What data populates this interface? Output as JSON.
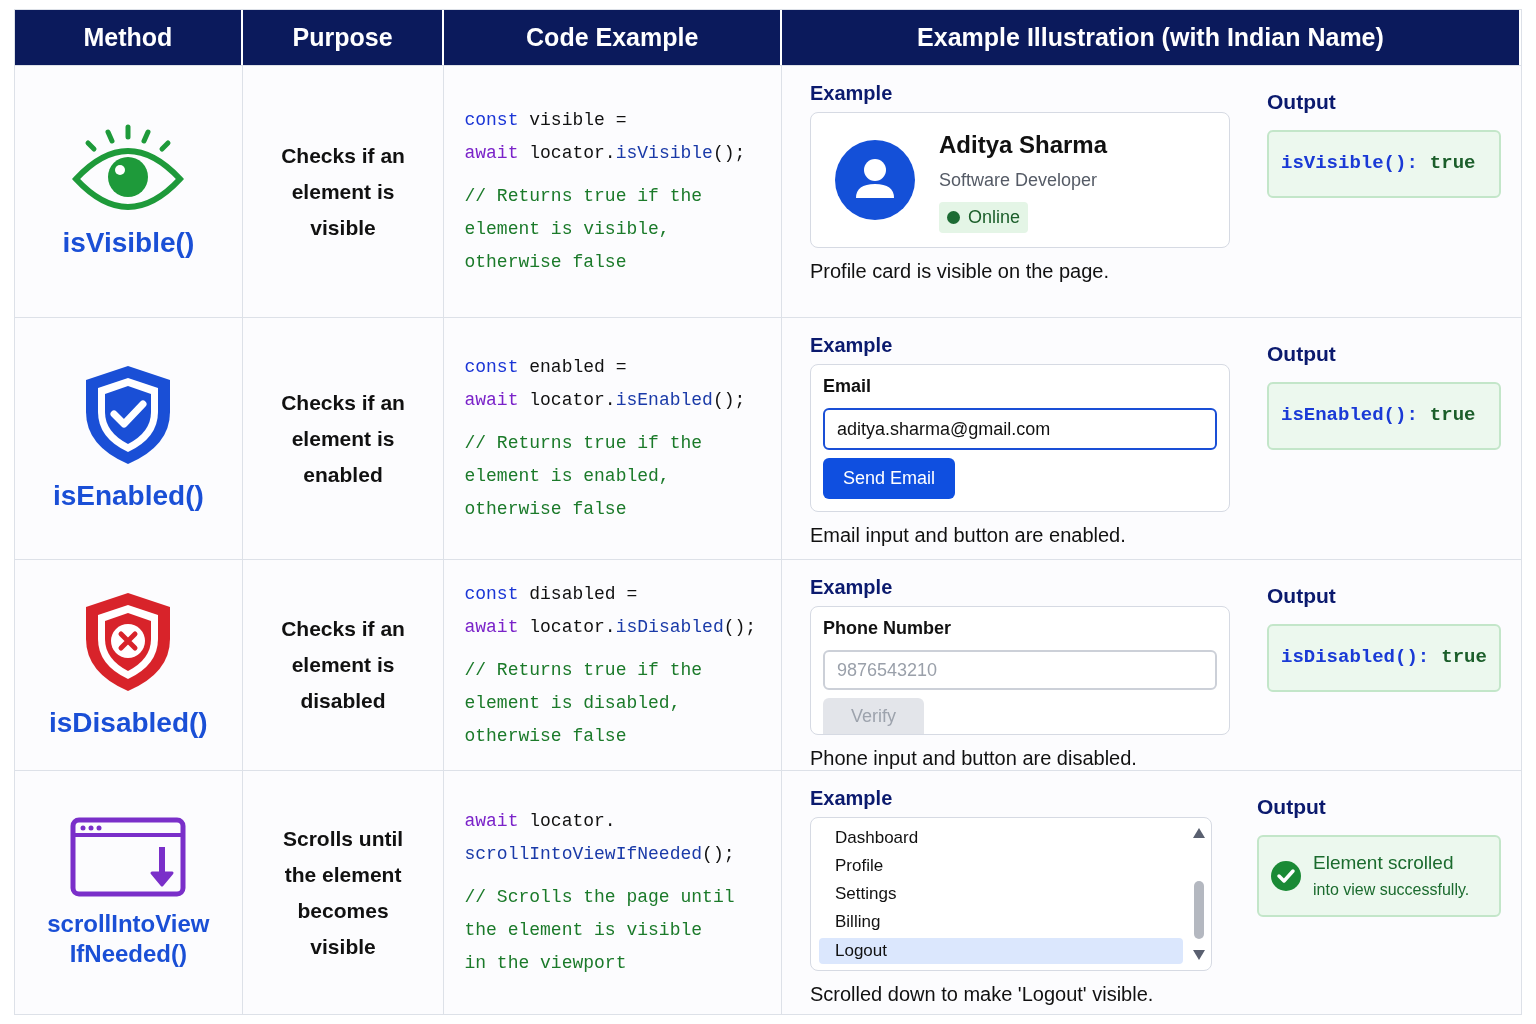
{
  "table": {
    "columns": [
      "Method",
      "Purpose",
      "Code Example",
      "Example Illustration (with Indian Name)"
    ],
    "rows": [
      {
        "kind": "eye",
        "method": [
          "isVisible()"
        ],
        "purpose": "Checks if an element is visible",
        "code": [
          [
            {
              "kind": "keyword",
              "text": "const"
            },
            {
              "kind": "plain",
              "text": " visible ="
            }
          ],
          [
            {
              "kind": "await",
              "text": "await"
            },
            {
              "kind": "plain",
              "text": " locator."
            },
            {
              "kind": "method",
              "text": "isVisible"
            },
            {
              "kind": "plain",
              "text": "();"
            }
          ]
        ],
        "comment": [
          "// Returns true if the",
          "element is visible,",
          "otherwise false"
        ],
        "example": {
          "kind": "profile",
          "label": "Example",
          "name": "Aditya Sharma",
          "role": "Software Developer",
          "status": "Online",
          "caption": "Profile card is visible on the page."
        },
        "output": {
          "kind": "code",
          "label": "Output",
          "call": "isVisible():",
          "value": "true"
        }
      },
      {
        "kind": "shield-check",
        "method": [
          "isEnabled()"
        ],
        "purpose": "Checks if an element is enabled",
        "code": [
          [
            {
              "kind": "keyword",
              "text": "const"
            },
            {
              "kind": "plain",
              "text": " enabled ="
            }
          ],
          [
            {
              "kind": "await",
              "text": "await"
            },
            {
              "kind": "plain",
              "text": " locator."
            },
            {
              "kind": "method",
              "text": "isEnabled"
            },
            {
              "kind": "plain",
              "text": "();"
            }
          ]
        ],
        "comment": [
          "// Returns true if the",
          "element is enabled,",
          "otherwise false"
        ],
        "example": {
          "kind": "form",
          "label": "Example",
          "field_label": "Email",
          "value": "aditya.sharma@gmail.com",
          "button": "Send Email",
          "disabled": false,
          "caption": "Email input and button are enabled."
        },
        "output": {
          "kind": "code",
          "label": "Output",
          "call": "isEnabled():",
          "value": "true"
        }
      },
      {
        "kind": "shield-x",
        "method": [
          "isDisabled()"
        ],
        "purpose": "Checks if an element is disabled",
        "code": [
          [
            {
              "kind": "keyword",
              "text": "const"
            },
            {
              "kind": "plain",
              "text": " disabled ="
            }
          ],
          [
            {
              "kind": "await",
              "text": "await"
            },
            {
              "kind": "plain",
              "text": " locator."
            },
            {
              "kind": "method",
              "text": "isDisabled"
            },
            {
              "kind": "plain",
              "text": "();"
            }
          ]
        ],
        "comment": [
          "// Returns true if the",
          "element is disabled,",
          "otherwise false"
        ],
        "example": {
          "kind": "form",
          "label": "Example",
          "field_label": "Phone Number",
          "value": "9876543210",
          "button": "Verify",
          "disabled": true,
          "caption": "Phone input and button are disabled."
        },
        "output": {
          "kind": "code",
          "label": "Output",
          "call": "isDisabled():",
          "value": "true"
        }
      },
      {
        "kind": "window-arrow",
        "method": [
          "scrollIntoView",
          "IfNeeded()"
        ],
        "purpose": "Scrolls until the element becomes visible",
        "code": [
          [
            {
              "kind": "await",
              "text": "await"
            },
            {
              "kind": "plain",
              "text": " locator."
            }
          ],
          [
            {
              "kind": "method",
              "text": "scrollIntoViewIfNeeded"
            },
            {
              "kind": "plain",
              "text": "();"
            }
          ]
        ],
        "comment": [
          "// Scrolls the page until",
          "the element is visible",
          "in the viewport"
        ],
        "example": {
          "kind": "list",
          "label": "Example",
          "items": [
            {
              "label": "Dashboard",
              "selected": false
            },
            {
              "label": "Profile",
              "selected": false
            },
            {
              "label": "Settings",
              "selected": false
            },
            {
              "label": "Billing",
              "selected": false
            },
            {
              "label": "Logout",
              "selected": true
            }
          ],
          "caption": "Scrolled down to make 'Logout' visible."
        },
        "output": {
          "kind": "message",
          "label": "Output",
          "lines": [
            "Element scrolled",
            "into view successfully."
          ]
        }
      }
    ]
  }
}
